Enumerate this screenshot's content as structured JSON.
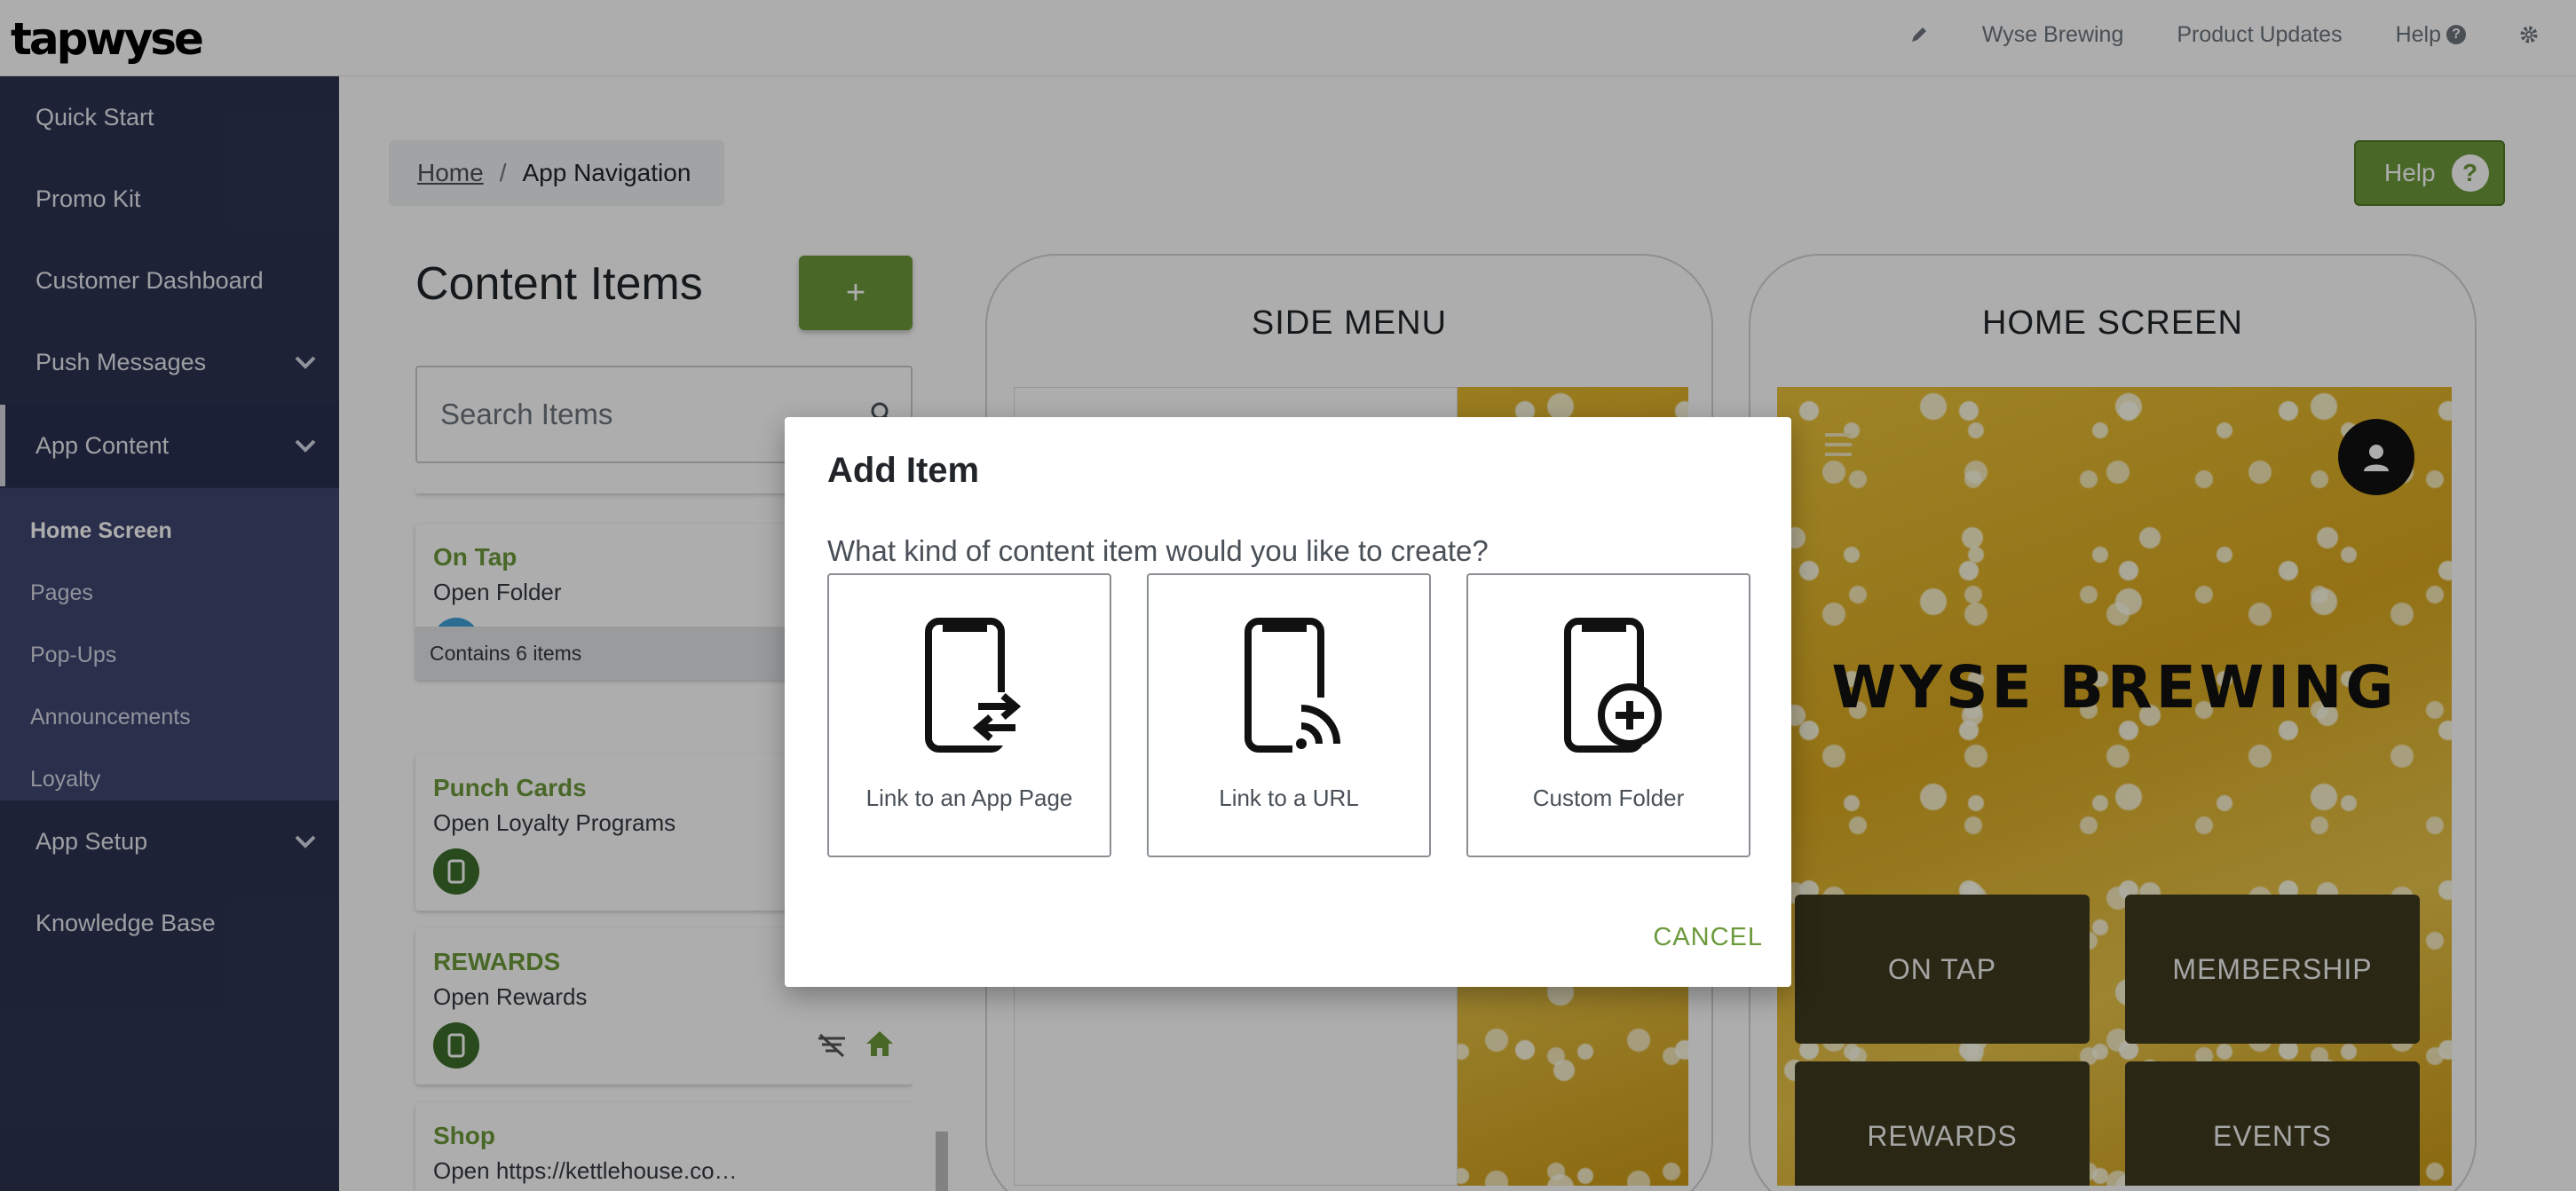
{
  "app": {
    "logo": "tapwyse"
  },
  "topnav": {
    "account": "Wyse Brewing",
    "updates": "Product Updates",
    "help": "Help"
  },
  "sidebar": {
    "items": [
      {
        "label": "Quick Start"
      },
      {
        "label": "Promo Kit"
      },
      {
        "label": "Customer Dashboard"
      },
      {
        "label": "Push Messages"
      },
      {
        "label": "App Content"
      },
      {
        "label": "App Setup"
      },
      {
        "label": "Knowledge Base"
      }
    ],
    "sub": [
      {
        "label": "Home Screen"
      },
      {
        "label": "Pages"
      },
      {
        "label": "Pop-Ups"
      },
      {
        "label": "Announcements"
      },
      {
        "label": "Loyalty"
      }
    ]
  },
  "breadcrumb": {
    "home": "Home",
    "sep": "/",
    "current": "App Navigation"
  },
  "help_button": {
    "label": "Help",
    "icon": "?"
  },
  "content": {
    "title": "Content Items",
    "add": "+",
    "search_placeholder": "Search Items",
    "cards": [
      {
        "title": "On Tap",
        "sub": "Open Folder",
        "footer": "Contains 6 items"
      },
      {
        "title": "Punch Cards",
        "sub": "Open Loyalty Programs"
      },
      {
        "title": "REWARDS",
        "sub": "Open Rewards"
      },
      {
        "title": "Shop",
        "sub": "Open https://kettlehouse.co…"
      }
    ]
  },
  "preview": {
    "side_menu_title": "SIDE MENU",
    "home_screen_title": "HOME SCREEN",
    "brand": "WYSE BREWING",
    "tiles": [
      "ON TAP",
      "MEMBERSHIP",
      "REWARDS",
      "EVENTS"
    ]
  },
  "modal": {
    "title": "Add Item",
    "question": "What kind of content item would you like to create?",
    "options": [
      {
        "label": "Link to an App Page",
        "icon": "phone-swap-icon"
      },
      {
        "label": "Link to a URL",
        "icon": "phone-signal-icon"
      },
      {
        "label": "Custom Folder",
        "icon": "phone-plus-icon"
      }
    ],
    "cancel": "CANCEL"
  },
  "colors": {
    "accent": "#6c9a3c",
    "sidebar": "#2d3352",
    "subnav": "#3f4670"
  }
}
